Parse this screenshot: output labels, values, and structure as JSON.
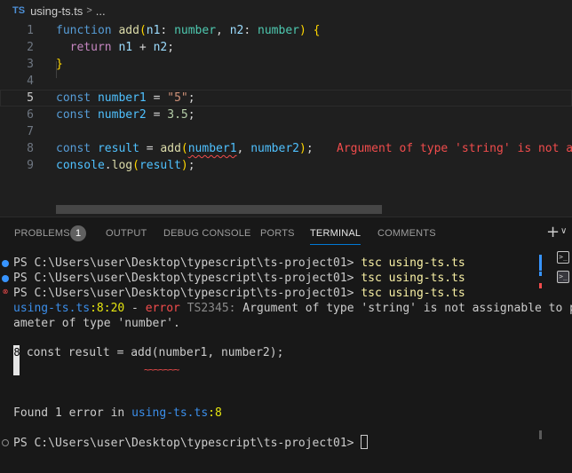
{
  "breadcrumb": {
    "badge": "TS",
    "file": "using-ts.ts",
    "sep": ">",
    "ellipsis": "..."
  },
  "editor": {
    "line_numbers": [
      "1",
      "2",
      "3",
      "4",
      "5",
      "6",
      "7",
      "8",
      "9"
    ],
    "l1": {
      "kw": "function",
      "fn": "add",
      "p1": "n1",
      "t1": "number",
      "p2": "n2",
      "t2": "number"
    },
    "l2": {
      "kw": "return",
      "a": "n1",
      "op": " + ",
      "b": "n2"
    },
    "l5": {
      "kw": "const",
      "name": "number1",
      "value": "\"5\""
    },
    "l6": {
      "kw": "const",
      "name": "number2",
      "value": "3.5"
    },
    "l8": {
      "kw": "const",
      "name": "result",
      "fn": "add",
      "a1": "number1",
      "a2": "number2",
      "error": "Argument of type 'string' is not a"
    },
    "l9": {
      "obj": "console",
      "method": "log",
      "arg": "result"
    }
  },
  "panel": {
    "tabs": [
      {
        "label": "PROBLEMS"
      },
      {
        "label": "OUTPUT"
      },
      {
        "label": "DEBUG CONSOLE"
      },
      {
        "label": "PORTS"
      },
      {
        "label": "TERMINAL"
      },
      {
        "label": "COMMENTS"
      }
    ],
    "problems_count": "1",
    "plus": "+",
    "chevron": "∨"
  },
  "terminal": {
    "prompt": "PS C:\\Users\\user\\Desktop\\typescript\\ts-project01> ",
    "command": "tsc using-ts.ts",
    "error_file": "using-ts.ts",
    "error_pos": ":8:20",
    "error_dash": " - ",
    "error_word": "error",
    "error_code": " TS2345:",
    "error_msg1": " Argument of type 'string' is not assignable to par",
    "error_msg2": "ameter of type 'number'.",
    "gutter_num": "8",
    "snippet": " const result = add(number1, number2);",
    "squiggle": "~~~~~~~",
    "found_prefix": "Found 1 error in ",
    "found_file": "using-ts.ts",
    "found_line": ":8"
  }
}
